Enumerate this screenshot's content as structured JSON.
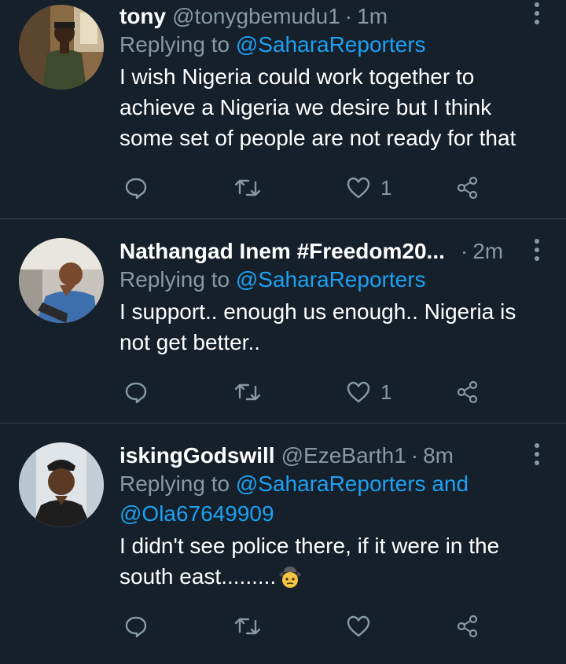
{
  "colors": {
    "background": "#15202b",
    "text_primary": "#ffffff",
    "text_secondary": "#8899a6",
    "link": "#1da1f2",
    "divider": "#38444d"
  },
  "tweets": [
    {
      "name": "tony",
      "handle": "@tonygbemudu1",
      "separator": "·",
      "time": "1m",
      "reply_prefix": "Replying to",
      "reply_mention": "@SaharaReporters",
      "reply_extra": "",
      "reply_line2": "",
      "text_lines": [
        "I wish Nigeria could work together to",
        "achieve a Nigeria we desire but I think",
        "some set of people are not ready for that"
      ],
      "emoji": "",
      "like_count": "1",
      "icons": [
        "reply-icon",
        "retweet-icon",
        "like-icon",
        "share-icon"
      ]
    },
    {
      "name": "Nathangad Inem #Freedom20...",
      "handle": "",
      "separator": "·",
      "time": "2m",
      "reply_prefix": "Replying to",
      "reply_mention": "@SaharaReporters",
      "reply_extra": "",
      "reply_line2": "",
      "text_lines": [
        "I support.. enough us enough.. Nigeria is",
        "not get better.."
      ],
      "emoji": "",
      "like_count": "1",
      "icons": [
        "reply-icon",
        "retweet-icon",
        "like-icon",
        "share-icon"
      ]
    },
    {
      "name": "iskingGodswill",
      "handle": "@EzeBarth1",
      "separator": "·",
      "time": "8m",
      "reply_prefix": "Replying to",
      "reply_mention": "@SaharaReporters",
      "reply_extra": "and",
      "reply_line2": "@Ola67649909",
      "text_lines": [
        "I didn't see police there, if it were in the",
        "south east........."
      ],
      "emoji": "detective-emoji",
      "like_count": "",
      "icons": [
        "reply-icon",
        "retweet-icon",
        "like-icon",
        "share-icon"
      ]
    }
  ]
}
